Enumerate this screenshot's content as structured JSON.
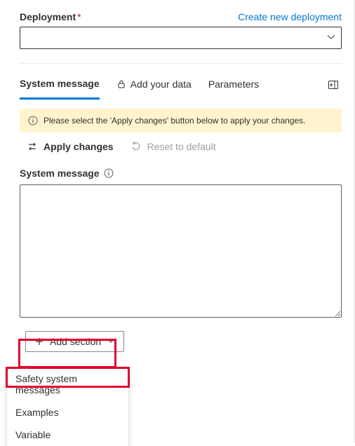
{
  "header": {
    "deployment_label": "Deployment",
    "create_link": "Create new deployment"
  },
  "tabs": {
    "system_message": "System message",
    "add_your_data": "Add your data",
    "parameters": "Parameters"
  },
  "notice": "Please select the 'Apply changes' button below to apply your changes.",
  "actions": {
    "apply": "Apply changes",
    "reset": "Reset to default"
  },
  "system_message": {
    "label": "System message",
    "value": ""
  },
  "add_section": {
    "label": "Add section",
    "options": {
      "safety": "Safety system messages",
      "examples": "Examples",
      "variable": "Variable"
    }
  }
}
